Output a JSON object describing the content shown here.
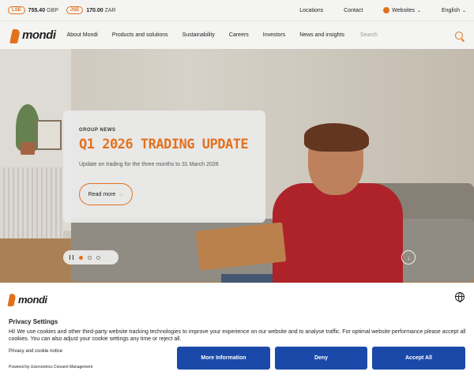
{
  "topbar": {
    "tickers": [
      {
        "exchange": "LSE",
        "value": "755.40",
        "currency": "GBP"
      },
      {
        "exchange": "JSE",
        "value": "170.00",
        "currency": "ZAR"
      }
    ],
    "links": {
      "locations": "Locations",
      "contact": "Contact",
      "websites": "Websites",
      "language": "English"
    }
  },
  "header": {
    "logo_text": "mondi",
    "nav": [
      "About Mondi",
      "Products and solutions",
      "Sustainability",
      "Careers",
      "Investors",
      "News and insights"
    ],
    "search_placeholder": "Search"
  },
  "hero": {
    "eyebrow": "GROUP NEWS",
    "title": "Q1 2026 TRADING UPDATE",
    "description": "Update on trading for the three months to 31 March 2026",
    "read_more": "Read more",
    "read_more_arrow": "→",
    "scroll_arrow": "↓"
  },
  "consent": {
    "logo_text": "mondi",
    "title": "Privacy Settings",
    "text": "Hi! We use cookies and other third-party website tracking technologies to improve your experience on our website and to analyse traffic. For optimal website performance please accept all cookies. You can also adjust your cookie settings any time or reject all.",
    "policy_link": "Privacy and cookie notice",
    "powered_by": "Powered by Usercentrics Consent Management",
    "buttons": {
      "more": "More Information",
      "deny": "Deny",
      "accept": "Accept All"
    }
  },
  "colors": {
    "accent": "#e2711d",
    "consent_button": "#1a49a9"
  }
}
